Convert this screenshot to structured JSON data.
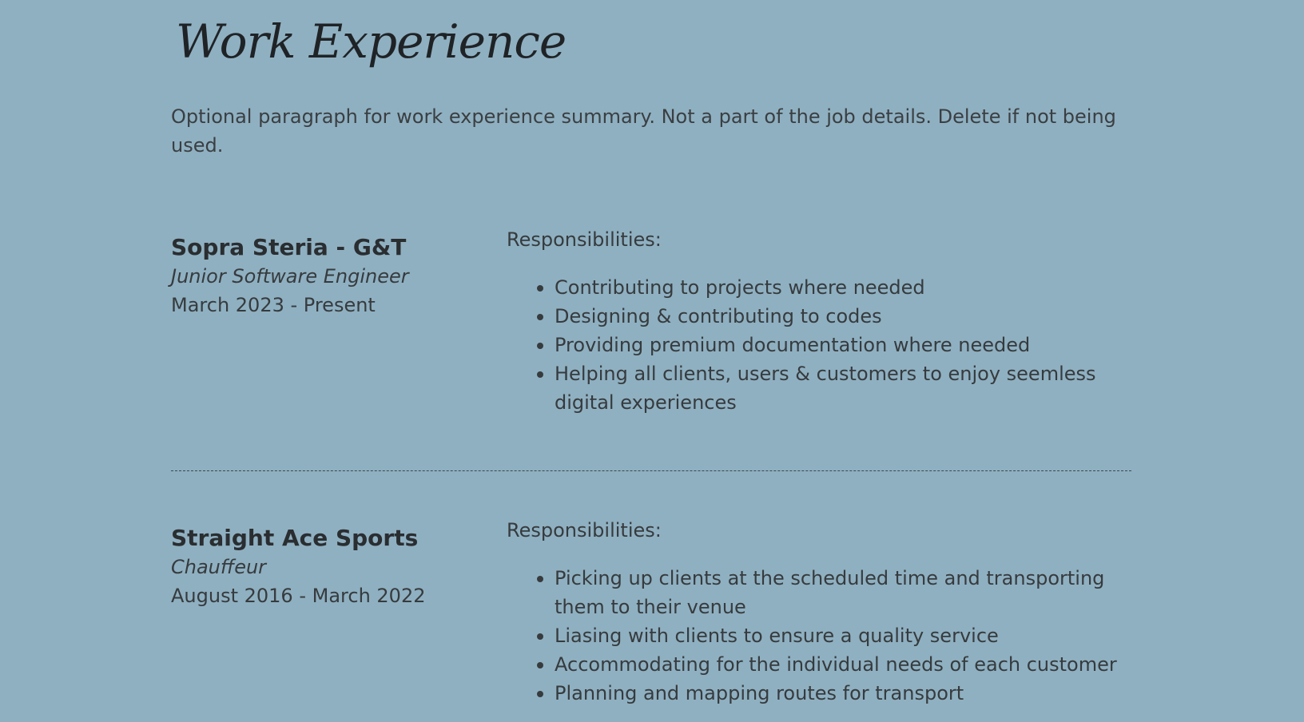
{
  "section": {
    "title": "Work Experience",
    "summary": "Optional paragraph for work experience summary. Not a part of the job details. Delete if not being used."
  },
  "jobs": [
    {
      "company": "Sopra Steria - G&T",
      "role": "Junior Software Engineer",
      "dates": "March 2023 - Present",
      "responsibilities_label": "Responsibilities:",
      "responsibilities": [
        "Contributing to projects where needed",
        "Designing & contributing to codes",
        "Providing premium documentation where needed",
        "Helping all clients, users & customers to enjoy seemless digital experiences"
      ]
    },
    {
      "company": "Straight Ace Sports",
      "role": "Chauffeur",
      "dates": "August 2016 - March 2022",
      "responsibilities_label": "Responsibilities:",
      "responsibilities": [
        "Picking up clients at the scheduled time and transporting them to their venue",
        "Liasing with clients to ensure a quality service",
        "Accommodating for the individual needs of each customer",
        "Planning and mapping routes for transport"
      ]
    }
  ]
}
